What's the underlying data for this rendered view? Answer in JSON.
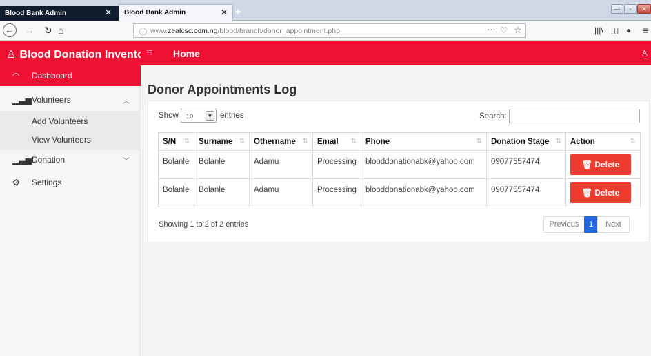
{
  "browser": {
    "tabs": [
      {
        "title": "Blood Bank Admin",
        "close": "✕"
      },
      {
        "title": "Blood Bank Admin",
        "close": "✕"
      }
    ],
    "new_tab": "+",
    "url_prefix": "www.",
    "url_domain": "zealcsc.com.ng",
    "url_path": "/blood/branch/donor_appointment.php",
    "url_dots": "···"
  },
  "topbar": {
    "brand": "Blood Donation Inventory",
    "home": "Home"
  },
  "sidebar": {
    "items": [
      {
        "label": "Dashboard",
        "icon": "dashboard-icon"
      },
      {
        "label": "Volunteers",
        "icon": "bar-chart-icon"
      },
      {
        "label": "Add Volunteers"
      },
      {
        "label": "View Volunteers"
      },
      {
        "label": "Donation",
        "icon": "bar-chart-icon"
      },
      {
        "label": "Settings",
        "icon": "gear-icon"
      }
    ]
  },
  "main": {
    "title": "Donor Appointments Log",
    "show_label": "Show",
    "entries_value": "10",
    "entries_label": "entries",
    "search_label": "Search:",
    "search_value": "",
    "columns": [
      "S/N",
      "Surname",
      "Othername",
      "Email",
      "Phone",
      "Donation Stage",
      "Action"
    ],
    "rows": [
      {
        "sn": "Bolanle",
        "surname": "Bolanle",
        "othername": "Adamu",
        "email": "Processing",
        "phone": "blooddonationabk@yahoo.com",
        "stage": "09077557474",
        "action": "Delete"
      },
      {
        "sn": "Bolanle",
        "surname": "Bolanle",
        "othername": "Adamu",
        "email": "Processing",
        "phone": "blooddonationabk@yahoo.com",
        "stage": "09077557474",
        "action": "Delete"
      }
    ],
    "info": "Showing 1 to 2 of 2 entries",
    "pager": {
      "previous": "Previous",
      "page": "1",
      "next": "Next"
    }
  },
  "colors": {
    "accent": "#ee1133",
    "delete": "#ee3b2f",
    "pager_active": "#2266dd"
  }
}
